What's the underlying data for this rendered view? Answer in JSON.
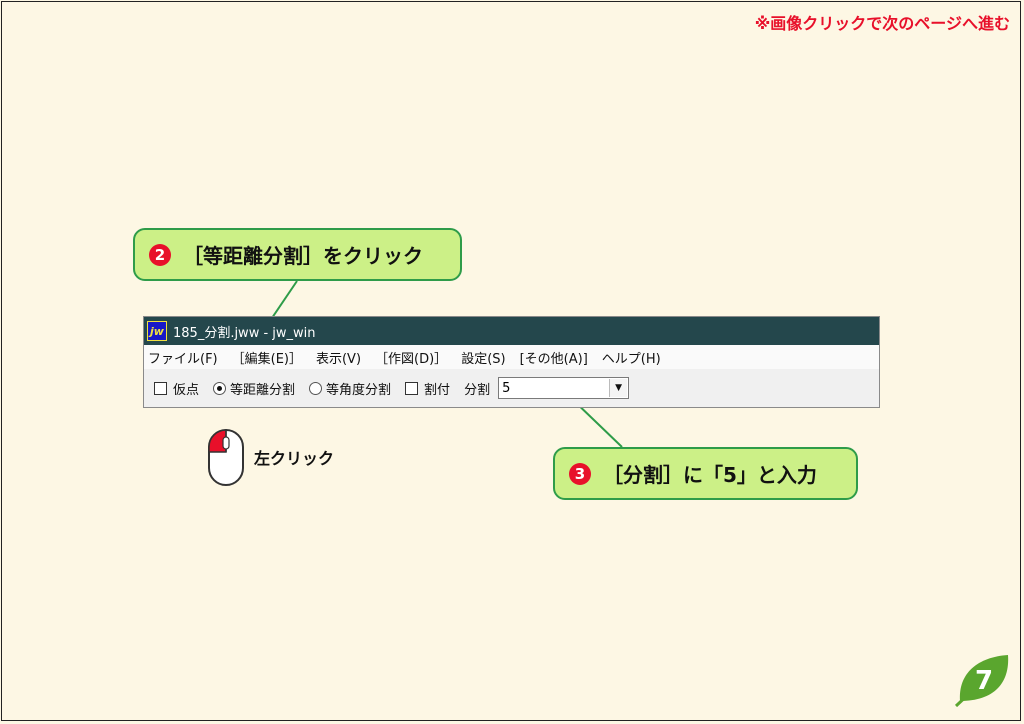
{
  "nav_note": "※画像クリックで次のページへ進む",
  "callouts": {
    "step2": {
      "num": "2",
      "text": "［等距離分割］をクリック"
    },
    "step3": {
      "num": "3",
      "text": "［分割］に「5」と入力"
    }
  },
  "window": {
    "title": "185_分割.jww - jw_win",
    "icon_text": "jw",
    "menu": [
      "ファイル(F)",
      "［編集(E)］",
      "表示(V)",
      "［作図(D)］",
      "設定(S)",
      "[その他(A)]",
      "ヘルプ(H)"
    ],
    "toolbar": {
      "kari_label": "仮点",
      "equal_distance_label": "等距離分割",
      "equal_angle_label": "等角度分割",
      "wari_label": "割付",
      "bunkatsu_label": "分割",
      "bunkatsu_value": "5"
    }
  },
  "mouse_label": "左クリック",
  "page_number": "7",
  "colors": {
    "accent_red": "#e8102a",
    "callout_bg": "#ccf087",
    "callout_border": "#2e9c49",
    "titlebar": "#24474c",
    "page_leaf": "#5aa62e"
  }
}
